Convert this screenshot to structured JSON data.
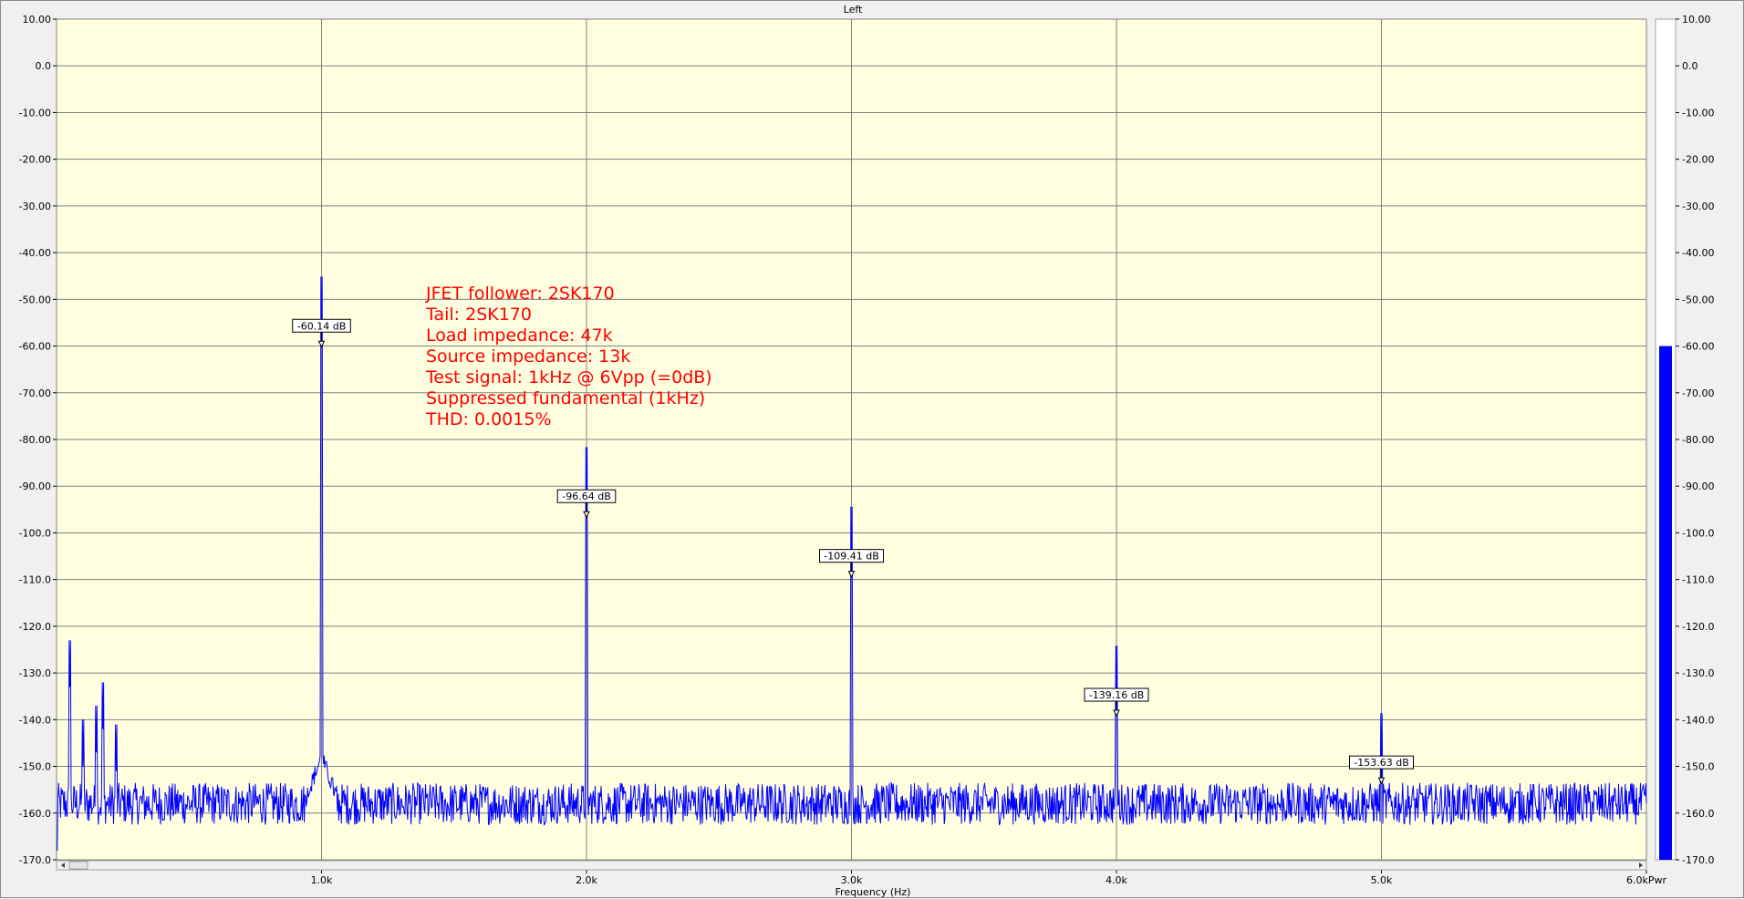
{
  "chart_data": {
    "type": "line",
    "title": "Left",
    "xlabel": "Frequency (Hz)",
    "ylabel": "",
    "xlim": [
      0,
      6000
    ],
    "ylim": [
      -170,
      10
    ],
    "grid": true,
    "x_ticks": [
      1000,
      2000,
      3000,
      4000,
      5000,
      6000
    ],
    "x_tick_labels": [
      "1.0k",
      "2.0k",
      "3.0k",
      "4.0k",
      "5.0k",
      "6.0kPwr"
    ],
    "y_ticks": [
      10,
      0,
      -10,
      -20,
      -30,
      -40,
      -50,
      -60,
      -70,
      -80,
      -90,
      -100,
      -110,
      -120,
      -130,
      -140,
      -150,
      -160,
      -170
    ],
    "y_tick_labels": [
      "10.00",
      "0.0",
      "-10.00",
      "-20.00",
      "-30.00",
      "-40.00",
      "-50.00",
      "-60.00",
      "-70.00",
      "-80.00",
      "-90.00",
      "-100.0",
      "-110.0",
      "-120.0",
      "-130.0",
      "-140.0",
      "-150.0",
      "-160.0",
      "-170.0"
    ],
    "series": [
      {
        "color": "#0000ff",
        "noise_floor_db": -158,
        "peaks": [
          {
            "x": 1000,
            "y": -60.14
          },
          {
            "x": 2000,
            "y": -96.64
          },
          {
            "x": 3000,
            "y": -109.41
          },
          {
            "x": 4000,
            "y": -139.16
          },
          {
            "x": 5000,
            "y": -153.63
          },
          {
            "x": 50,
            "y": -133
          },
          {
            "x": 100,
            "y": -150
          },
          {
            "x": 150,
            "y": -147
          },
          {
            "x": 175,
            "y": -142
          },
          {
            "x": 225,
            "y": -151
          }
        ]
      }
    ],
    "markers": [
      {
        "x": 1000,
        "y": -60.14,
        "label": "-60.14 dB"
      },
      {
        "x": 2000,
        "y": -96.64,
        "label": "-96.64 dB"
      },
      {
        "x": 3000,
        "y": -109.41,
        "label": "-109.41 dB"
      },
      {
        "x": 4000,
        "y": -139.16,
        "label": "-139.16 dB"
      },
      {
        "x": 5000,
        "y": -153.63,
        "label": "-153.63 dB"
      }
    ],
    "annotations": [
      "JFET follower: 2SK170",
      "Tail: 2SK170",
      "Load impedance: 47k",
      "Source impedance: 13k",
      "Test signal: 1kHz @ 6Vpp (=0dB)",
      "Suppressed fundamental (1kHz)",
      "THD: 0.0015%"
    ]
  },
  "level_meter": {
    "value_db": -60,
    "ylim": [
      -170,
      10
    ],
    "color": "#0000ff",
    "tick_labels": [
      "10.00",
      "0.0",
      "-10.00",
      "-20.00",
      "-30.00",
      "-40.00",
      "-50.00",
      "-60.00",
      "-70.00",
      "-80.00",
      "-90.00",
      "-100.0",
      "-110.0",
      "-120.0",
      "-130.0",
      "-140.0",
      "-150.0",
      "-160.0",
      "-170.0"
    ]
  },
  "colors": {
    "plot_background": "#ffffe0",
    "grid": "#808080",
    "trace": "#0000ff",
    "annotation": "#ff0000"
  }
}
